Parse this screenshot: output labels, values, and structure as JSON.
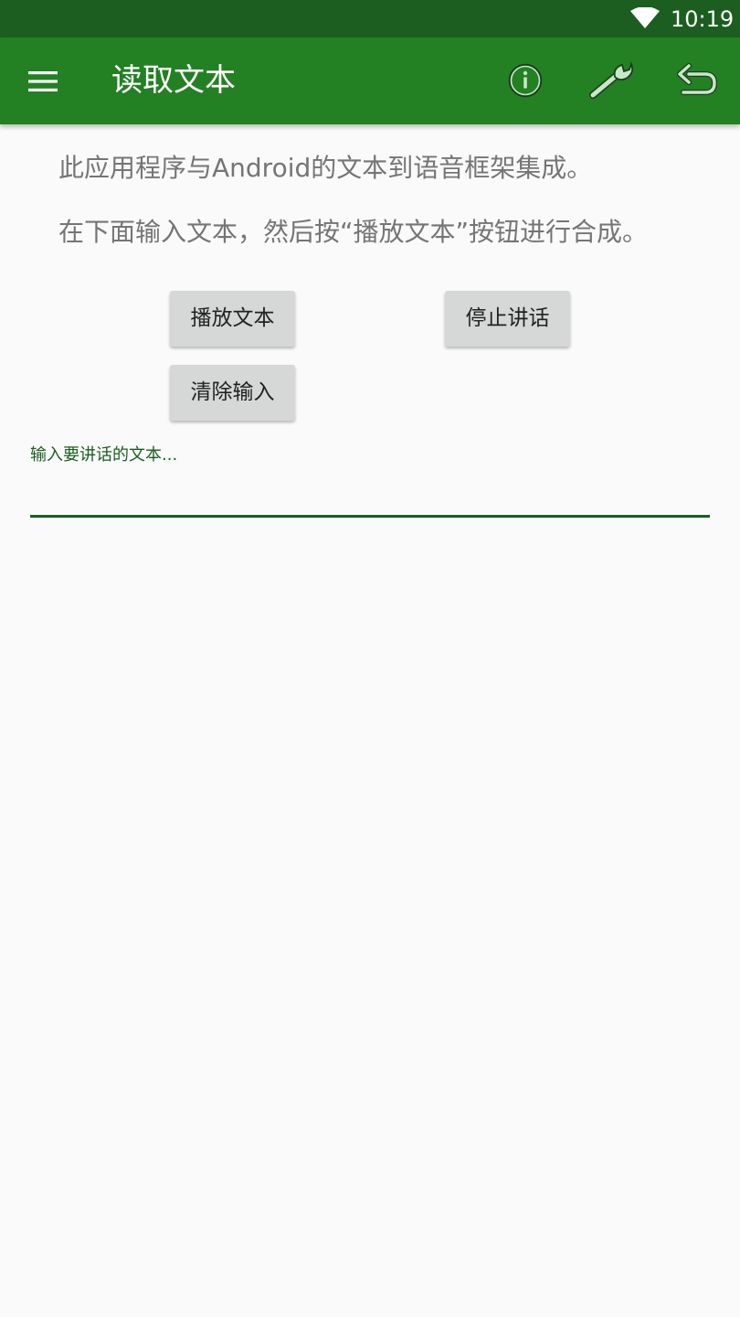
{
  "status_bar": {
    "time": "10:19",
    "icons": [
      "wifi-icon"
    ]
  },
  "app_bar": {
    "title": "读取文本",
    "icons": [
      "menu-icon",
      "info-icon",
      "wrench-icon",
      "undo-icon"
    ],
    "color": "#238023"
  },
  "intro": {
    "line1": "此应用程序与Android的文本到语音框架集成。",
    "line2": "在下面输入文本，然后按“播放文本”按钮进行合成。"
  },
  "buttons": {
    "play": "播放文本",
    "stop": "停止讲话",
    "clear": "清除输入"
  },
  "input": {
    "label": "输入要讲话的文本...",
    "value": ""
  },
  "colors": {
    "status_bar": "#1b5e20",
    "accent": "#1b5e20",
    "background": "#fafafa"
  }
}
